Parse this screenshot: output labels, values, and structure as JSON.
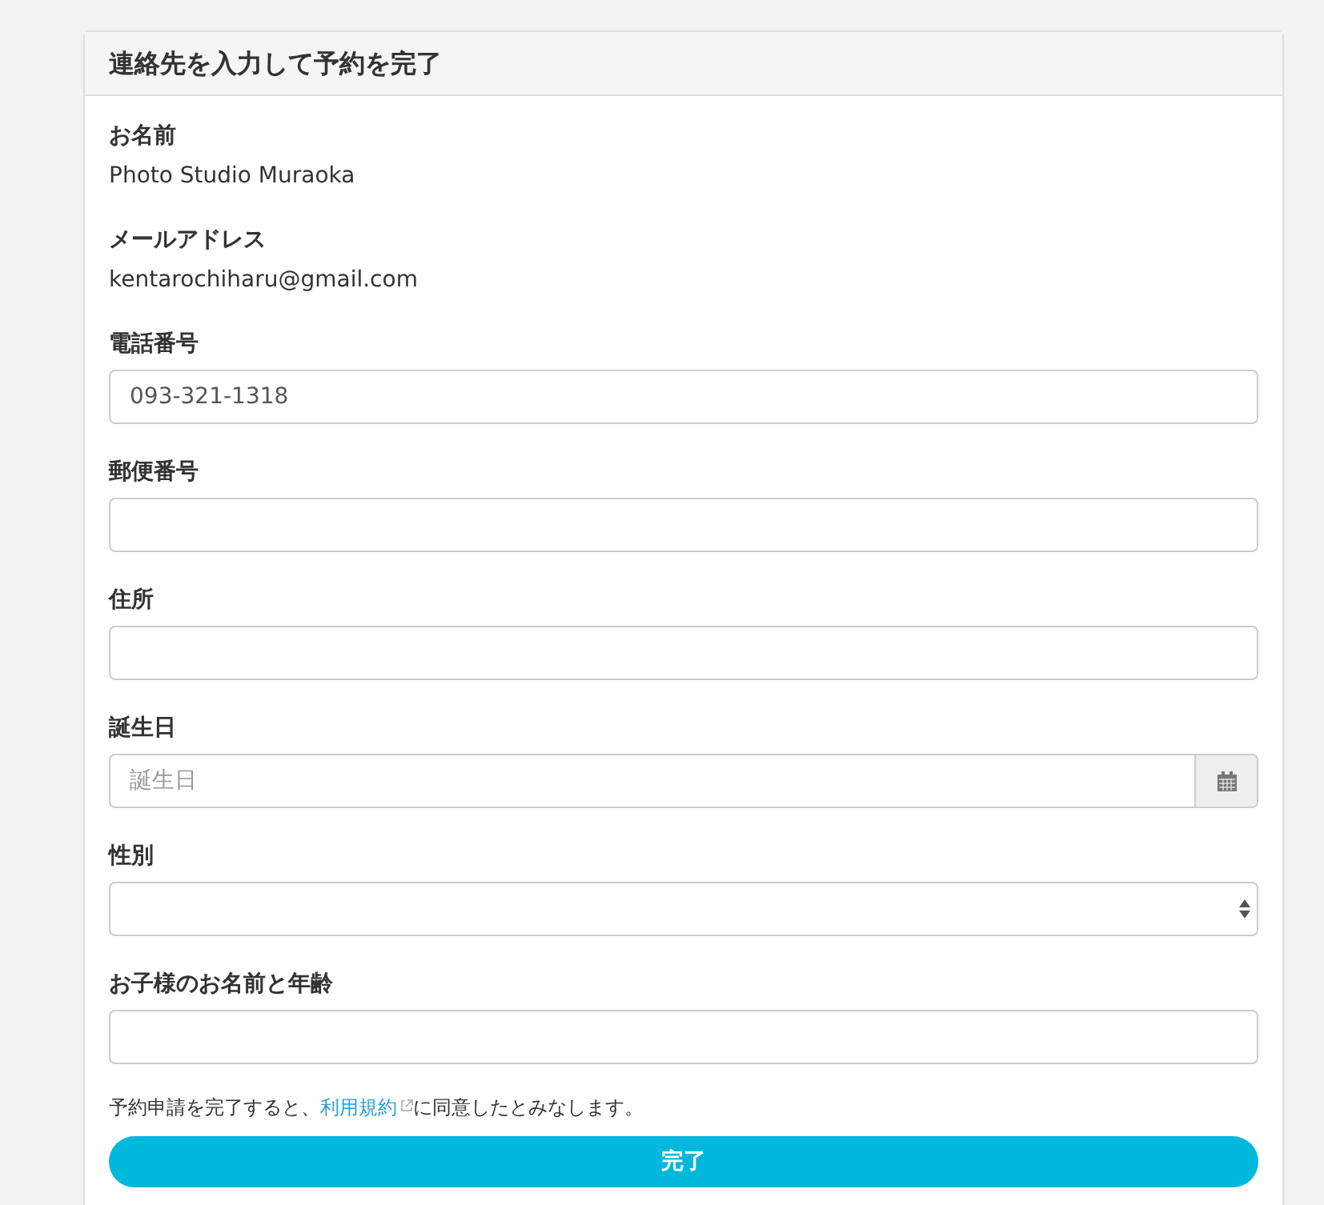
{
  "panel": {
    "title": "連絡先を入力して予約を完了"
  },
  "fields": [
    {
      "kind": "static",
      "label": "お名前",
      "value": "Photo Studio Muraoka"
    },
    {
      "kind": "static",
      "label": "メールアドレス",
      "value": "kentarochiharu@gmail.com"
    },
    {
      "kind": "input",
      "label": "電話番号",
      "value": "093-321-1318"
    },
    {
      "kind": "input",
      "label": "郵便番号"
    },
    {
      "kind": "input",
      "label": "住所"
    },
    {
      "kind": "date",
      "label": "誕生日",
      "placeholder": "誕生日"
    },
    {
      "kind": "select",
      "label": "性別"
    },
    {
      "kind": "input",
      "label": "お子様のお名前と年齢"
    }
  ],
  "notice": {
    "before": "予約申請を完了すると、",
    "link": "利用規約",
    "after": "に同意したとみなします。"
  },
  "submit_button": "完了"
}
